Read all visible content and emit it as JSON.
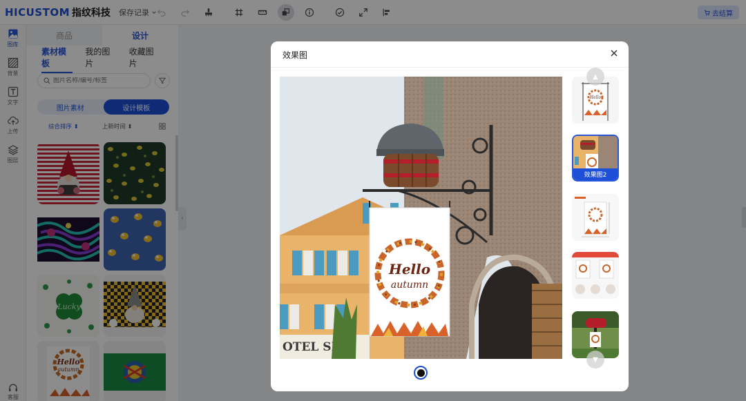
{
  "header": {
    "logo_main": "HICUSTOM",
    "logo_sub": "指纹科技",
    "save_record": "保存记录",
    "checkout_label": "去结算"
  },
  "rail": {
    "items": [
      {
        "label": "图库",
        "icon": "image-icon",
        "active": true
      },
      {
        "label": "背景",
        "icon": "pattern-icon",
        "active": false
      },
      {
        "label": "文字",
        "icon": "text-icon",
        "active": false
      },
      {
        "label": "上传",
        "icon": "upload-cloud-icon",
        "active": false
      },
      {
        "label": "图层",
        "icon": "layers-icon",
        "active": false
      }
    ],
    "service_label": "客服"
  },
  "panel": {
    "tabs": [
      {
        "label": "商品",
        "active": false
      },
      {
        "label": "设计",
        "active": true
      }
    ],
    "sub_tabs": [
      {
        "label": "素材模板",
        "active": true
      },
      {
        "label": "我的图片",
        "active": false
      },
      {
        "label": "收藏图片",
        "active": false
      }
    ],
    "search": {
      "placeholder": "图片名称/编号/标签",
      "value": ""
    },
    "segment": [
      {
        "label": "图片素材",
        "active": false
      },
      {
        "label": "设计模板",
        "active": true
      }
    ],
    "sort": {
      "primary": "综合排序",
      "secondary": "上新时间"
    }
  },
  "modal": {
    "title": "效果图",
    "selected_thumb_label": "效果图2",
    "flag_text_line1": "Hello",
    "flag_text_line2": "autumn",
    "storefront_text": "OTEL SE"
  },
  "colors": {
    "brand_blue": "#1e4fd8",
    "accent_light": "#dbe6ff"
  }
}
